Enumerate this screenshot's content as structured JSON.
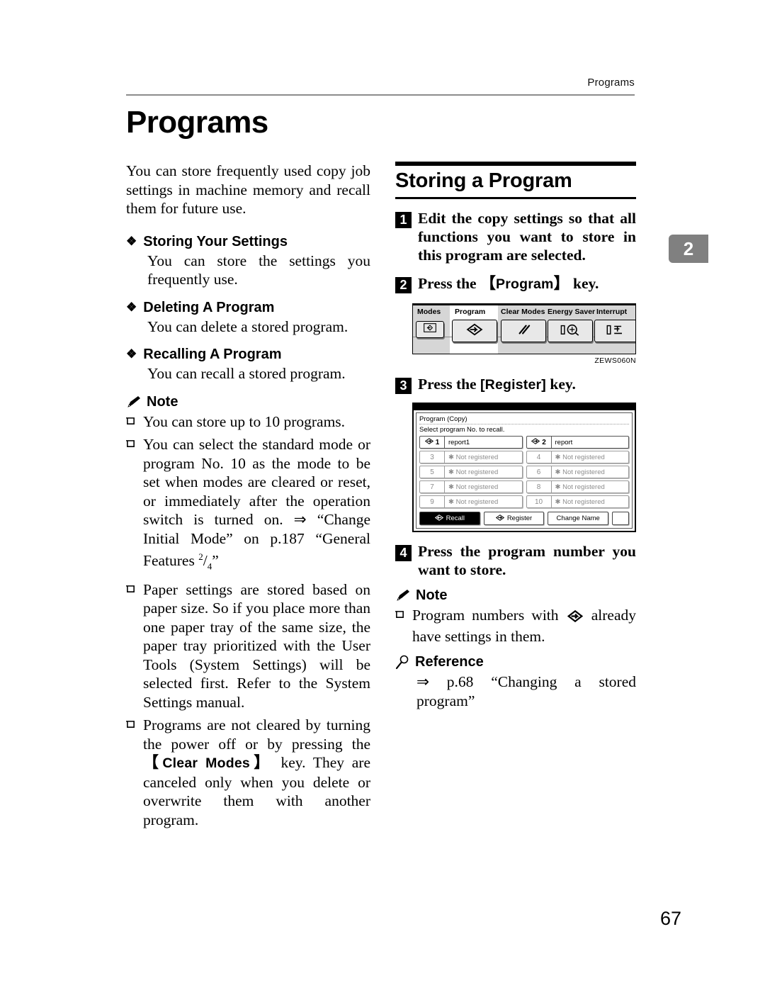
{
  "header": {
    "running_head": "Programs"
  },
  "chapter_tab": {
    "number": "2"
  },
  "title": "Programs",
  "left_column": {
    "intro": "You can store frequently used copy job settings in machine memory and recall them for future use.",
    "features": [
      {
        "bullet": "❖",
        "heading": "Storing Your Settings",
        "body": "You can store the settings you frequently use."
      },
      {
        "bullet": "❖",
        "heading": "Deleting A Program",
        "body": "You can delete a stored program."
      },
      {
        "bullet": "❖",
        "heading": "Recalling A Program",
        "body": "You can recall a stored program."
      }
    ],
    "note_heading": "Note",
    "notes": [
      {
        "text": "You can store up to 10 programs."
      },
      {
        "text_before": "You can select the standard mode or program No. 10 as the mode to be set when modes are cleared or reset, or immediately after the operation switch is turned on. ⇒ “Change Initial Mode” on p.187 “General Features ",
        "fraction_numerator": "2",
        "fraction_denominator": "4",
        "text_after": "”"
      },
      {
        "text": "Paper settings are stored based on paper size. So if you place more than one paper tray of the same size, the paper tray prioritized with the User Tools (System Settings) will be selected first. Refer to the System Settings manual."
      },
      {
        "text_before": "Programs are not cleared by turning the power off or by pressing the ",
        "key_label": "Clear Modes",
        "text_after": " key. They are canceled only when you delete or overwrite them with another program."
      }
    ]
  },
  "right_column": {
    "section_title": "Storing a Program",
    "steps": [
      {
        "number": "1",
        "text": "Edit the copy settings so that all functions you want to store in this program are selected."
      },
      {
        "number": "2",
        "text_before": "Press the ",
        "key_label": "Program",
        "key_bracket_open": "【",
        "key_bracket_close": "】",
        "text_after": " key."
      },
      {
        "number": "3",
        "text_before": "Press the ",
        "key_label": "[Register]",
        "text_after": " key."
      },
      {
        "number": "4",
        "text": "Press the program number you want to store."
      }
    ],
    "control_panel_figure": {
      "buttons": [
        {
          "label": "Modes",
          "icon": "program-diamond-icon",
          "highlighted": false
        },
        {
          "label": "Program",
          "icon": "program-diamond-icon",
          "highlighted": true
        },
        {
          "label": "Clear Modes",
          "icon": "clear-modes-icon",
          "highlighted": false
        },
        {
          "label": "Energy Saver",
          "icon": "energy-saver-icon",
          "highlighted": false
        },
        {
          "label": "Interrupt",
          "icon": "interrupt-icon",
          "highlighted": false
        }
      ],
      "figure_code": "ZEWS060N"
    },
    "lcd_figure": {
      "title": "Program (Copy)",
      "instruction": "Select program No. to recall.",
      "programs": [
        {
          "number": "1",
          "name": "report1",
          "registered": true
        },
        {
          "number": "2",
          "name": "report",
          "registered": true
        },
        {
          "number": "3",
          "name": "Not registered",
          "registered": false
        },
        {
          "number": "4",
          "name": "Not registered",
          "registered": false
        },
        {
          "number": "5",
          "name": "Not registered",
          "registered": false
        },
        {
          "number": "6",
          "name": "Not registered",
          "registered": false
        },
        {
          "number": "7",
          "name": "Not registered",
          "registered": false
        },
        {
          "number": "8",
          "name": "Not registered",
          "registered": false
        },
        {
          "number": "9",
          "name": "Not registered",
          "registered": false
        },
        {
          "number": "10",
          "name": "Not registered",
          "registered": false
        }
      ],
      "buttons": [
        {
          "label": "Recall",
          "selected": true
        },
        {
          "label": "Register",
          "selected": false
        },
        {
          "label": "Change Name",
          "selected": false
        }
      ]
    },
    "note_heading": "Note",
    "notes": [
      {
        "text_before": "Program numbers with ",
        "icon": "program-diamond-icon",
        "text_after": " already have settings in them."
      }
    ],
    "reference_heading": "Reference",
    "reference_text": "⇒ p.68 “Changing a stored program”"
  },
  "page_number": "67"
}
